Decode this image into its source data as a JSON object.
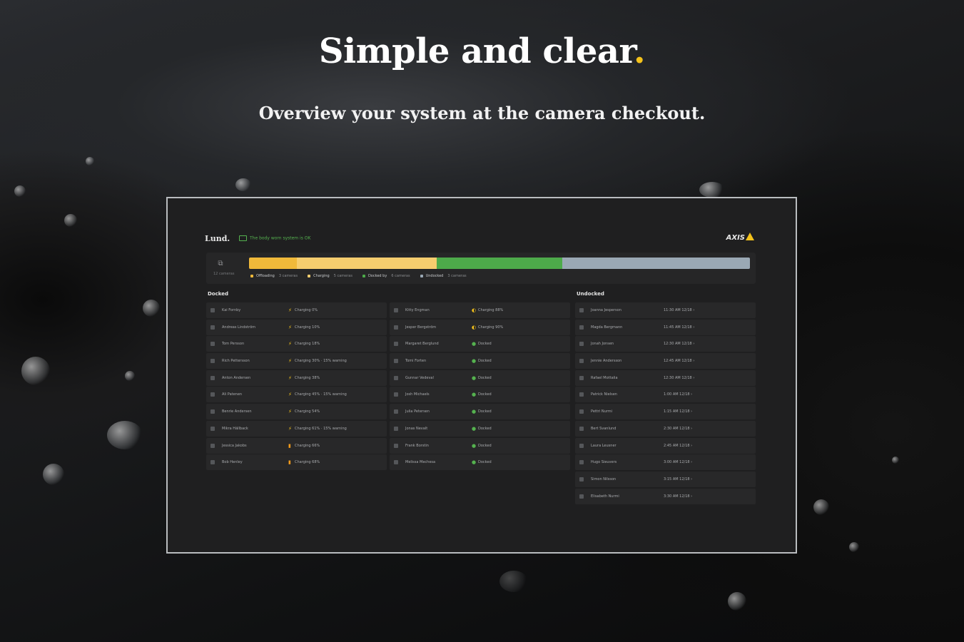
{
  "hero": {
    "title": "Simple and clear",
    "title_dot": ".",
    "subtitle": "Overview your system at the camera checkout."
  },
  "app": {
    "brand": "Lund.",
    "sync_status": "The body worn system is OK",
    "vendor_logo": "AXIS",
    "colors": {
      "accent": "#f4c21b",
      "charging_dark": "#f0b93a",
      "charging_light": "#f6cd6e",
      "docked": "#4daa4a",
      "undocked": "#9aa8b4"
    },
    "summary": {
      "camera_icon": "camera-stack-icon",
      "camera_label": "12 cameras",
      "bar_segments": [
        {
          "key": "offloading",
          "fraction": 0.095,
          "color": "#f0b93a"
        },
        {
          "key": "charging",
          "fraction": 0.28,
          "color": "#f6cd6e"
        },
        {
          "key": "docked",
          "fraction": 0.25,
          "color": "#4daa4a"
        },
        {
          "key": "undocked",
          "fraction": 0.375,
          "color": "#9aa8b4"
        }
      ],
      "legend": [
        {
          "label": "Offloading",
          "count": "3 cameras",
          "color": "#f0b93a"
        },
        {
          "label": "Charging",
          "count": "5 cameras",
          "color": "#f6cd6e"
        },
        {
          "label": "Docked by",
          "count": "6 cameras",
          "color": "#4daa4a"
        },
        {
          "label": "Undocked",
          "count": "3 cameras",
          "color": "#9aa8b4"
        }
      ]
    },
    "docked": {
      "title": "Docked",
      "left_column": [
        {
          "name": "Kai Fornby",
          "status": "Charging 0%",
          "icon": "charging-icon"
        },
        {
          "name": "Andreas Lindström",
          "status": "Charging 10%",
          "icon": "charging-icon"
        },
        {
          "name": "Tom Persson",
          "status": "Charging 18%",
          "icon": "charging-icon"
        },
        {
          "name": "Rich Pettersson",
          "status": "Charging 30% · 15% warning",
          "icon": "charging-icon"
        },
        {
          "name": "Anton Andersen",
          "status": "Charging 38%",
          "icon": "charging-icon"
        },
        {
          "name": "Ali Patenen",
          "status": "Charging 45% · 15% warning",
          "icon": "charging-icon"
        },
        {
          "name": "Benrie Andersen",
          "status": "Charging 54%",
          "icon": "charging-icon"
        },
        {
          "name": "Mikra Hällback",
          "status": "Charging 61% · 15% warning",
          "icon": "charging-icon"
        },
        {
          "name": "Jessica Jakobs",
          "status": "Charging 66%",
          "icon": "battery-icon"
        },
        {
          "name": "Bob Henley",
          "status": "Charging 68%",
          "icon": "battery-icon"
        }
      ],
      "right_column": [
        {
          "name": "Kitty Engman",
          "status": "Charging 88%",
          "icon": "offload-icon"
        },
        {
          "name": "Jesper Bergström",
          "status": "Charging 90%",
          "icon": "offload-icon"
        },
        {
          "name": "Margaret Berglund",
          "status": "Docked",
          "icon": "docked-icon"
        },
        {
          "name": "Tomi Forten",
          "status": "Docked",
          "icon": "docked-icon"
        },
        {
          "name": "Gunnar Vedeval",
          "status": "Docked",
          "icon": "docked-icon"
        },
        {
          "name": "Josh Michaels",
          "status": "Docked",
          "icon": "docked-icon"
        },
        {
          "name": "Julia Petersen",
          "status": "Docked",
          "icon": "docked-icon"
        },
        {
          "name": "Jonas Nevalt",
          "status": "Docked",
          "icon": "docked-icon"
        },
        {
          "name": "Frank Borstin",
          "status": "Docked",
          "icon": "docked-icon"
        },
        {
          "name": "Melissa Mechesa",
          "status": "Docked",
          "icon": "docked-icon"
        }
      ]
    },
    "undocked": {
      "title": "Undocked",
      "rows": [
        {
          "name": "Joanna Jesperson",
          "time": "11:30 AM 12/18 ›"
        },
        {
          "name": "Magda Bergmann",
          "time": "11:45 AM 12/18 ›"
        },
        {
          "name": "Jonah Jonsen",
          "time": "12:30 AM 12/18 ›"
        },
        {
          "name": "Jennie Andersson",
          "time": "12:45 AM 12/18 ›"
        },
        {
          "name": "Rafael Mottalia",
          "time": "12:30 AM 12/18 ›"
        },
        {
          "name": "Patrick Nielsen",
          "time": "1:00 AM 12/18 ›"
        },
        {
          "name": "Pettri Nurmi",
          "time": "1:15 AM 12/18 ›"
        },
        {
          "name": "Bert Svanlund",
          "time": "2:30 AM 12/18 ›"
        },
        {
          "name": "Laura Leusner",
          "time": "2:45 AM 12/18 ›"
        },
        {
          "name": "Hugo Sieuvers",
          "time": "3:00 AM 12/18 ›"
        },
        {
          "name": "Simon Nilsson",
          "time": "3:15 AM 12/18 ›"
        },
        {
          "name": "Elisabeth Nurmi",
          "time": "3:30 AM 12/18 ›"
        }
      ]
    }
  }
}
